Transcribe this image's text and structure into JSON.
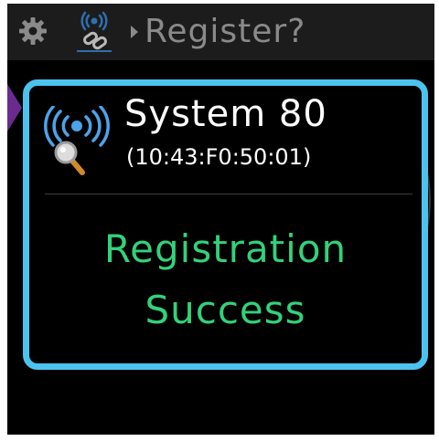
{
  "topbar": {
    "title": "Register?",
    "icons": [
      "gear-icon",
      "link-icon",
      "chevron-right-icon"
    ]
  },
  "dialog": {
    "icon": "wireless-search-icon",
    "device_name": "System  80",
    "device_address": "(10:43:F0:50:01)",
    "status_line_1": "Registration",
    "status_line_2": "Success"
  },
  "colors": {
    "accent_border": "#4cc3ef",
    "success_text": "#33d17a",
    "topbar_background": "#1c1c1c",
    "side_arrow": "#6a2a8f"
  }
}
